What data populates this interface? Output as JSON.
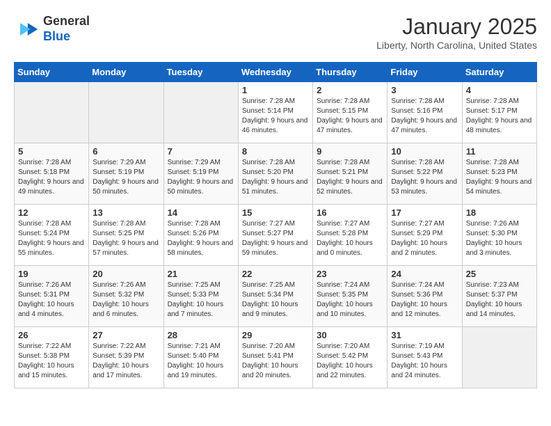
{
  "logo": {
    "general": "General",
    "blue": "Blue"
  },
  "title": "January 2025",
  "subtitle": "Liberty, North Carolina, United States",
  "days_of_week": [
    "Sunday",
    "Monday",
    "Tuesday",
    "Wednesday",
    "Thursday",
    "Friday",
    "Saturday"
  ],
  "weeks": [
    [
      {
        "day": "",
        "info": ""
      },
      {
        "day": "",
        "info": ""
      },
      {
        "day": "",
        "info": ""
      },
      {
        "day": "1",
        "info": "Sunrise: 7:28 AM\nSunset: 5:14 PM\nDaylight: 9 hours and 46 minutes."
      },
      {
        "day": "2",
        "info": "Sunrise: 7:28 AM\nSunset: 5:15 PM\nDaylight: 9 hours and 47 minutes."
      },
      {
        "day": "3",
        "info": "Sunrise: 7:28 AM\nSunset: 5:16 PM\nDaylight: 9 hours and 47 minutes."
      },
      {
        "day": "4",
        "info": "Sunrise: 7:28 AM\nSunset: 5:17 PM\nDaylight: 9 hours and 48 minutes."
      }
    ],
    [
      {
        "day": "5",
        "info": "Sunrise: 7:28 AM\nSunset: 5:18 PM\nDaylight: 9 hours and 49 minutes."
      },
      {
        "day": "6",
        "info": "Sunrise: 7:29 AM\nSunset: 5:19 PM\nDaylight: 9 hours and 50 minutes."
      },
      {
        "day": "7",
        "info": "Sunrise: 7:29 AM\nSunset: 5:19 PM\nDaylight: 9 hours and 50 minutes."
      },
      {
        "day": "8",
        "info": "Sunrise: 7:28 AM\nSunset: 5:20 PM\nDaylight: 9 hours and 51 minutes."
      },
      {
        "day": "9",
        "info": "Sunrise: 7:28 AM\nSunset: 5:21 PM\nDaylight: 9 hours and 52 minutes."
      },
      {
        "day": "10",
        "info": "Sunrise: 7:28 AM\nSunset: 5:22 PM\nDaylight: 9 hours and 53 minutes."
      },
      {
        "day": "11",
        "info": "Sunrise: 7:28 AM\nSunset: 5:23 PM\nDaylight: 9 hours and 54 minutes."
      }
    ],
    [
      {
        "day": "12",
        "info": "Sunrise: 7:28 AM\nSunset: 5:24 PM\nDaylight: 9 hours and 55 minutes."
      },
      {
        "day": "13",
        "info": "Sunrise: 7:28 AM\nSunset: 5:25 PM\nDaylight: 9 hours and 57 minutes."
      },
      {
        "day": "14",
        "info": "Sunrise: 7:28 AM\nSunset: 5:26 PM\nDaylight: 9 hours and 58 minutes."
      },
      {
        "day": "15",
        "info": "Sunrise: 7:27 AM\nSunset: 5:27 PM\nDaylight: 9 hours and 59 minutes."
      },
      {
        "day": "16",
        "info": "Sunrise: 7:27 AM\nSunset: 5:28 PM\nDaylight: 10 hours and 0 minutes."
      },
      {
        "day": "17",
        "info": "Sunrise: 7:27 AM\nSunset: 5:29 PM\nDaylight: 10 hours and 2 minutes."
      },
      {
        "day": "18",
        "info": "Sunrise: 7:26 AM\nSunset: 5:30 PM\nDaylight: 10 hours and 3 minutes."
      }
    ],
    [
      {
        "day": "19",
        "info": "Sunrise: 7:26 AM\nSunset: 5:31 PM\nDaylight: 10 hours and 4 minutes."
      },
      {
        "day": "20",
        "info": "Sunrise: 7:26 AM\nSunset: 5:32 PM\nDaylight: 10 hours and 6 minutes."
      },
      {
        "day": "21",
        "info": "Sunrise: 7:25 AM\nSunset: 5:33 PM\nDaylight: 10 hours and 7 minutes."
      },
      {
        "day": "22",
        "info": "Sunrise: 7:25 AM\nSunset: 5:34 PM\nDaylight: 10 hours and 9 minutes."
      },
      {
        "day": "23",
        "info": "Sunrise: 7:24 AM\nSunset: 5:35 PM\nDaylight: 10 hours and 10 minutes."
      },
      {
        "day": "24",
        "info": "Sunrise: 7:24 AM\nSunset: 5:36 PM\nDaylight: 10 hours and 12 minutes."
      },
      {
        "day": "25",
        "info": "Sunrise: 7:23 AM\nSunset: 5:37 PM\nDaylight: 10 hours and 14 minutes."
      }
    ],
    [
      {
        "day": "26",
        "info": "Sunrise: 7:22 AM\nSunset: 5:38 PM\nDaylight: 10 hours and 15 minutes."
      },
      {
        "day": "27",
        "info": "Sunrise: 7:22 AM\nSunset: 5:39 PM\nDaylight: 10 hours and 17 minutes."
      },
      {
        "day": "28",
        "info": "Sunrise: 7:21 AM\nSunset: 5:40 PM\nDaylight: 10 hours and 19 minutes."
      },
      {
        "day": "29",
        "info": "Sunrise: 7:20 AM\nSunset: 5:41 PM\nDaylight: 10 hours and 20 minutes."
      },
      {
        "day": "30",
        "info": "Sunrise: 7:20 AM\nSunset: 5:42 PM\nDaylight: 10 hours and 22 minutes."
      },
      {
        "day": "31",
        "info": "Sunrise: 7:19 AM\nSunset: 5:43 PM\nDaylight: 10 hours and 24 minutes."
      },
      {
        "day": "",
        "info": ""
      }
    ]
  ]
}
